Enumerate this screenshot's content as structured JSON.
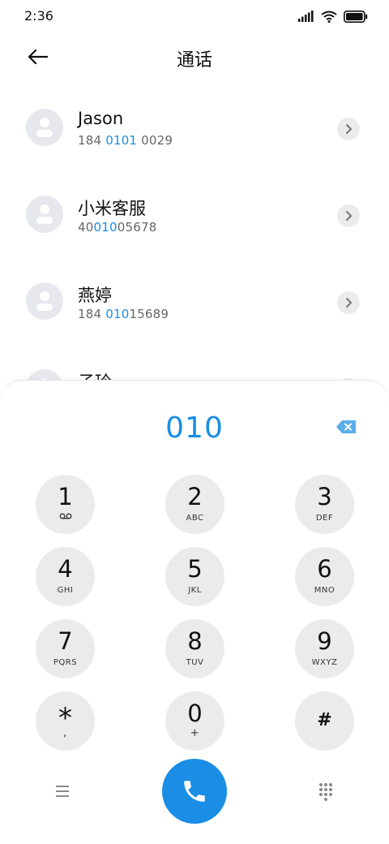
{
  "status_bar": {
    "time": "2:36"
  },
  "header": {
    "title": "通话"
  },
  "contacts": [
    {
      "name": "Jason",
      "number_parts": [
        "184 ",
        "0101",
        " 0029"
      ]
    },
    {
      "name": "小米客服",
      "number_parts": [
        "40",
        "010",
        "05678"
      ]
    },
    {
      "name": "燕婷",
      "number_parts": [
        "184 ",
        "010",
        "15689"
      ]
    },
    {
      "name": "子玲",
      "number_parts": [
        "",
        "",
        ""
      ]
    }
  ],
  "dialer": {
    "input": "010",
    "keys": [
      {
        "digit": "1",
        "sub": "",
        "sub_icon": "voicemail-icon"
      },
      {
        "digit": "2",
        "sub": "ABC"
      },
      {
        "digit": "3",
        "sub": "DEF"
      },
      {
        "digit": "4",
        "sub": "GHI"
      },
      {
        "digit": "5",
        "sub": "JKL"
      },
      {
        "digit": "6",
        "sub": "MNO"
      },
      {
        "digit": "7",
        "sub": "PQRS"
      },
      {
        "digit": "8",
        "sub": "TUV"
      },
      {
        "digit": "9",
        "sub": "WXYZ"
      },
      {
        "digit": "*",
        "sub": ","
      },
      {
        "digit": "0",
        "sub": "+"
      },
      {
        "digit": "#",
        "sub": ""
      }
    ]
  },
  "colors": {
    "accent": "#1a8de5",
    "key_bg": "#ebebeb",
    "avatar_bg": "#e6e8ee"
  }
}
